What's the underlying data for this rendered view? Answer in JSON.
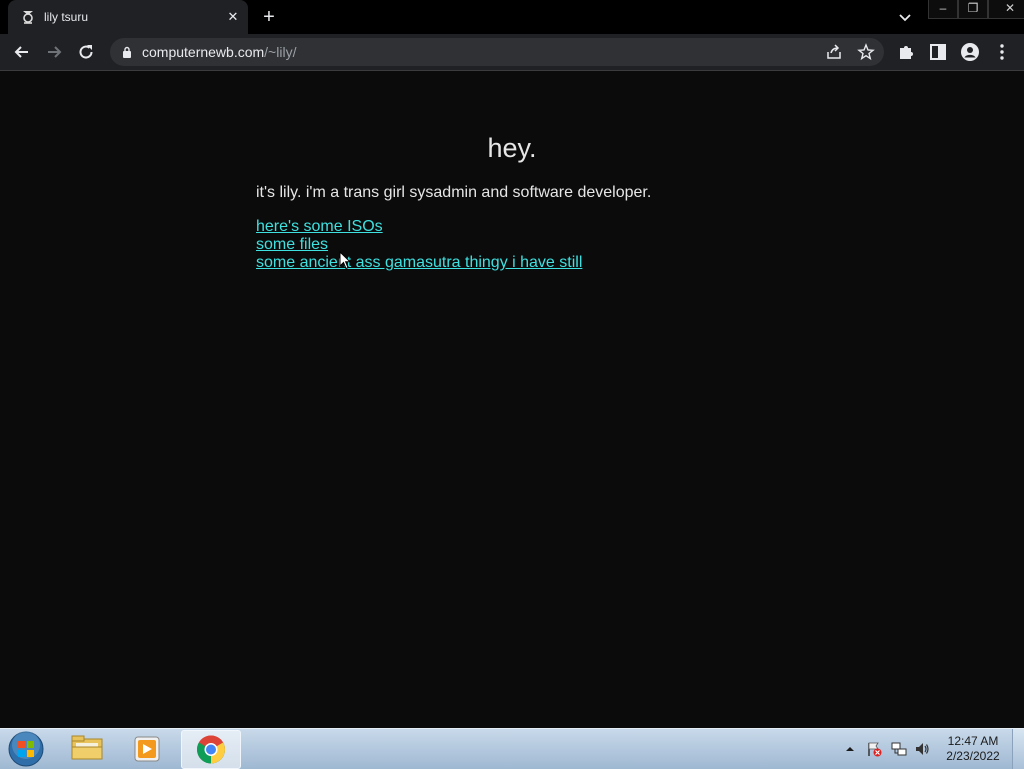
{
  "browser": {
    "tab": {
      "title": "lily tsuru",
      "favicon": "tab-favicon-icon",
      "close_glyph": "✕"
    },
    "new_tab_glyph": "+",
    "url": {
      "host": "computernewb.com",
      "path": "/~lily/"
    },
    "window_controls": {
      "minimize": "–",
      "restore": "❐",
      "close": "✕"
    }
  },
  "page": {
    "heading": "hey.",
    "intro": "it's lily. i'm a trans girl sysadmin and software developer.",
    "links": [
      {
        "label": "here's some ISOs"
      },
      {
        "label": "some files"
      },
      {
        "label": "some ancient ass gamasutra thingy i have still"
      }
    ],
    "colors": {
      "background": "#0b0b0b",
      "text": "#e6e6e6",
      "link": "#3fe0e0"
    }
  },
  "taskbar": {
    "clock": {
      "time": "12:47 AM",
      "date": "2/23/2022"
    },
    "pinned": [
      "windows-explorer-icon",
      "media-player-icon",
      "chrome-icon"
    ]
  }
}
